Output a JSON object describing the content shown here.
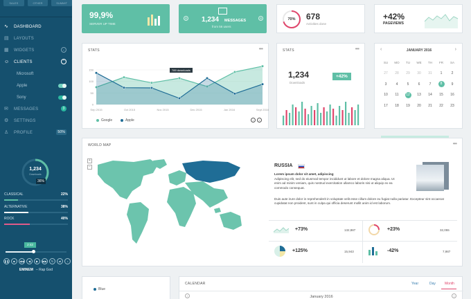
{
  "sidebar": {
    "top_tabs": [
      "SALES",
      "OTHER",
      "SUMMIT"
    ],
    "nav": [
      {
        "label": "DASHBOARD",
        "icon": "chart-line-icon"
      },
      {
        "label": "LAYOUTS",
        "icon": "layout-icon"
      },
      {
        "label": "WIDGETS",
        "icon": "grid-icon"
      },
      {
        "label": "CLIENTS",
        "icon": "users-icon"
      }
    ],
    "clients": [
      "Microsoft",
      "Apple",
      "Sony"
    ],
    "nav2": [
      {
        "label": "MESSAGES",
        "icon": "envelope-icon",
        "badge": "3"
      },
      {
        "label": "SETTINGS",
        "icon": "gear-icon"
      },
      {
        "label": "PROFILE",
        "icon": "user-icon",
        "badge": "50%"
      }
    ],
    "donut": {
      "value": "1,234",
      "sub": "Downloads",
      "pct": "36%",
      "fraction": 0.36
    },
    "bars": [
      {
        "name": "CLASSICAL",
        "pct": "22%",
        "fill": 0.22,
        "color": "#5fbfa6"
      },
      {
        "name": "ALTERNATIVE",
        "pct": "38%",
        "fill": 0.38,
        "color": "#ffffff"
      },
      {
        "name": "ROCK",
        "pct": "40%",
        "fill": 0.4,
        "color": "#e05b8a"
      }
    ],
    "player": {
      "time": "2:42",
      "progress": 0.45,
      "artist": "EMINEM",
      "song": "Rap God"
    }
  },
  "tiles": {
    "server": {
      "value": "99,9%",
      "label": "SERVER UP TIME"
    },
    "messages": {
      "count": "1,234",
      "word": "MESSAGES",
      "from": "from 56 users"
    },
    "activities": {
      "pct": "70%",
      "value": "678",
      "label": "Activities done",
      "fraction": 0.7
    },
    "pageviews": {
      "value": "+42%",
      "label": "PAGEVIEWS"
    }
  },
  "stats_main": {
    "title": "STATS",
    "tooltip": "789 downloads",
    "legend": [
      "Google",
      "Apple"
    ],
    "colors": {
      "google": "#5fbfa6",
      "apple": "#1f6d96"
    }
  },
  "chart_data": {
    "type": "line",
    "x": [
      "Sep 2015",
      "Oct 2015",
      "Nov 2015",
      "Dec 2015",
      "Jan 2016",
      "Sept 2016"
    ],
    "series": [
      {
        "name": "Google",
        "values": [
          75,
          118,
          94,
          114,
          78,
          141,
          166
        ]
      },
      {
        "name": "Apple",
        "values": [
          137,
          73,
          72,
          27,
          114,
          47,
          88
        ]
      }
    ],
    "ylim": [
      0,
      150
    ],
    "yticks": [
      0,
      50,
      100,
      150
    ]
  },
  "stats_small": {
    "title": "STATS",
    "value": "1,234",
    "label": "Downloads",
    "badge": "+42%"
  },
  "calendar_small": {
    "month": "JANUARY 2016",
    "days": [
      "SU",
      "MO",
      "TU",
      "WE",
      "TH",
      "FR",
      "SA"
    ],
    "weeks": [
      [
        "27",
        "28",
        "29",
        "30",
        "31",
        "1",
        "2"
      ],
      [
        "3",
        "4",
        "5",
        "6",
        "7",
        "8",
        "9"
      ],
      [
        "10",
        "11",
        "12",
        "13",
        "14",
        "15",
        "16"
      ],
      [
        "17",
        "18",
        "19",
        "20",
        "21",
        "22",
        "23"
      ]
    ]
  },
  "worldmap": {
    "title": "WORLD MAP",
    "country": "RUSSIA",
    "heading": "Lorem ipsum dolor sit amet, adipiscing",
    "para1": "Adipiscing elit, sed do eiusmod tempor incididunt ut labore et dolore magna aliqua. Ut enim ad minim veniam, quis nostrud exercitation ullamco laboris nisi ut aliquip ex ea commodo consequat.",
    "para2": "Duis aute irure dolor in reprehenderit in voluptate velit esse cillum dolore eu fugiat nulla pariatur. Excepteur sint occaecat cupidatat non proident, sunt in culpa qui officia deserunt mollit anim id est laborum.",
    "stats": [
      {
        "pct": "+73%",
        "num": "132,887"
      },
      {
        "pct": "+23%",
        "num": "32,055"
      },
      {
        "pct": "+125%",
        "num": "15,943"
      },
      {
        "pct": "-42%",
        "num": "7,987"
      }
    ]
  },
  "bottom": {
    "legend": "Blue",
    "calendar_title": "CALENDAR",
    "tabs": [
      "Year",
      "Day",
      "Month"
    ],
    "month": "January 2016"
  }
}
